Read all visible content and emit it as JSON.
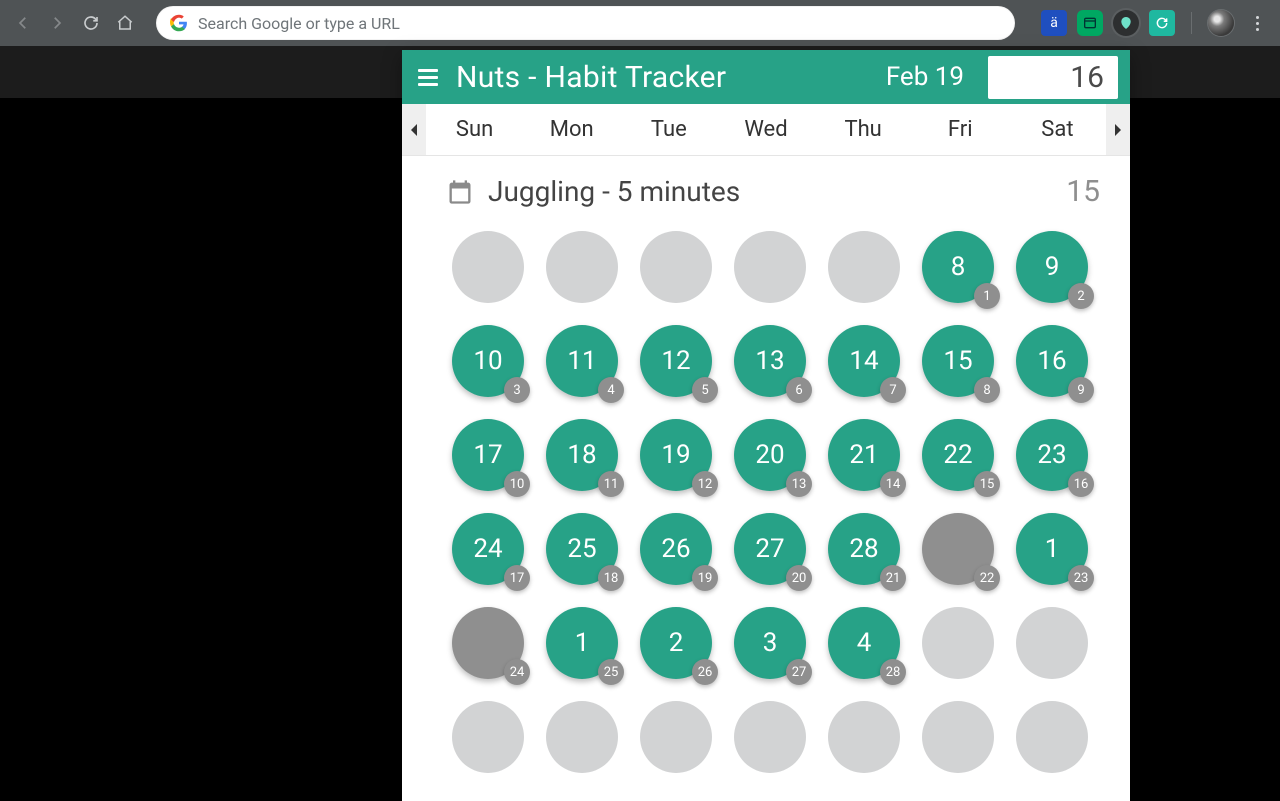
{
  "browser": {
    "search_placeholder": "Search Google or type a URL"
  },
  "panel": {
    "app_title": "Nuts - Habit Tracker",
    "header_date": "Feb 19",
    "header_count": "16"
  },
  "dow": [
    "Sun",
    "Mon",
    "Tue",
    "Wed",
    "Thu",
    "Fri",
    "Sat"
  ],
  "habit": {
    "name": "Juggling - 5 minutes",
    "total": "15"
  },
  "grid": [
    [
      {
        "state": "placeholder"
      },
      {
        "state": "placeholder"
      },
      {
        "state": "placeholder"
      },
      {
        "state": "placeholder"
      },
      {
        "state": "placeholder"
      },
      {
        "state": "green",
        "day": "8",
        "badge": "1"
      },
      {
        "state": "green",
        "day": "9",
        "badge": "2"
      }
    ],
    [
      {
        "state": "green",
        "day": "10",
        "badge": "3"
      },
      {
        "state": "green",
        "day": "11",
        "badge": "4"
      },
      {
        "state": "green",
        "day": "12",
        "badge": "5"
      },
      {
        "state": "green",
        "day": "13",
        "badge": "6"
      },
      {
        "state": "green",
        "day": "14",
        "badge": "7"
      },
      {
        "state": "green",
        "day": "15",
        "badge": "8"
      },
      {
        "state": "green",
        "day": "16",
        "badge": "9"
      }
    ],
    [
      {
        "state": "green",
        "day": "17",
        "badge": "10"
      },
      {
        "state": "green",
        "day": "18",
        "badge": "11"
      },
      {
        "state": "green",
        "day": "19",
        "badge": "12"
      },
      {
        "state": "green",
        "day": "20",
        "badge": "13"
      },
      {
        "state": "green",
        "day": "21",
        "badge": "14"
      },
      {
        "state": "green",
        "day": "22",
        "badge": "15"
      },
      {
        "state": "green",
        "day": "23",
        "badge": "16"
      }
    ],
    [
      {
        "state": "green",
        "day": "24",
        "badge": "17"
      },
      {
        "state": "green",
        "day": "25",
        "badge": "18"
      },
      {
        "state": "green",
        "day": "26",
        "badge": "19"
      },
      {
        "state": "green",
        "day": "27",
        "badge": "20"
      },
      {
        "state": "green",
        "day": "28",
        "badge": "21"
      },
      {
        "state": "missed",
        "badge": "22"
      },
      {
        "state": "green",
        "day": "1",
        "badge": "23"
      }
    ],
    [
      {
        "state": "missed",
        "badge": "24"
      },
      {
        "state": "green",
        "day": "1",
        "badge": "25"
      },
      {
        "state": "green",
        "day": "2",
        "badge": "26"
      },
      {
        "state": "green",
        "day": "3",
        "badge": "27"
      },
      {
        "state": "green",
        "day": "4",
        "badge": "28"
      },
      {
        "state": "future"
      },
      {
        "state": "future"
      }
    ],
    [
      {
        "state": "future"
      },
      {
        "state": "future"
      },
      {
        "state": "future"
      },
      {
        "state": "future"
      },
      {
        "state": "future"
      },
      {
        "state": "future"
      },
      {
        "state": "future"
      }
    ]
  ]
}
